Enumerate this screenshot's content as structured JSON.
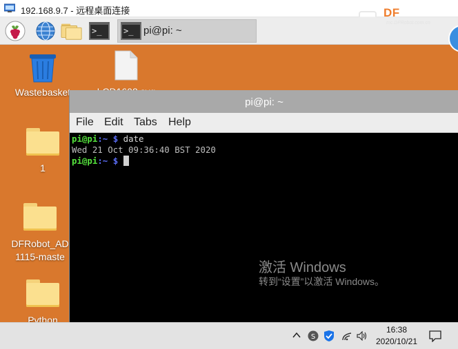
{
  "rdp": {
    "title": "192.168.9.7 - 远程桌面连接"
  },
  "watermark_logo": {
    "brand": "DF",
    "url": "mc.DFRobot.com.cn"
  },
  "panel": {
    "task_title": "pi@pi: ~",
    "launchers": [
      "raspberry-menu-icon",
      "web-browser-icon",
      "file-manager-icon",
      "terminal-icon"
    ]
  },
  "desktop": {
    "icons": [
      {
        "label": "Wastebasket"
      },
      {
        "label": "LCD1602.svg"
      },
      {
        "label": "1"
      },
      {
        "label_line1": "DFRobot_AD",
        "label_line2": "1115-maste"
      },
      {
        "label": "Python"
      }
    ]
  },
  "terminal": {
    "title": "pi@pi: ~",
    "menu": [
      "File",
      "Edit",
      "Tabs",
      "Help"
    ],
    "lines": [
      {
        "user": "pi@pi",
        "path": ":~",
        "prompt": " $ ",
        "cmd": "date"
      },
      {
        "output": "Wed 21 Oct 09:36:40 BST 2020"
      },
      {
        "user": "pi@pi",
        "path": ":~",
        "prompt": " $ ",
        "cmd": ""
      }
    ]
  },
  "activation": {
    "line1": "激活 Windows",
    "line2": "转到“设置”以激活 Windows。"
  },
  "taskbar": {
    "time": "16:38",
    "date": "2020/10/21",
    "colors": {
      "accent": "#0078d7",
      "desktop": "#d9782d"
    }
  }
}
